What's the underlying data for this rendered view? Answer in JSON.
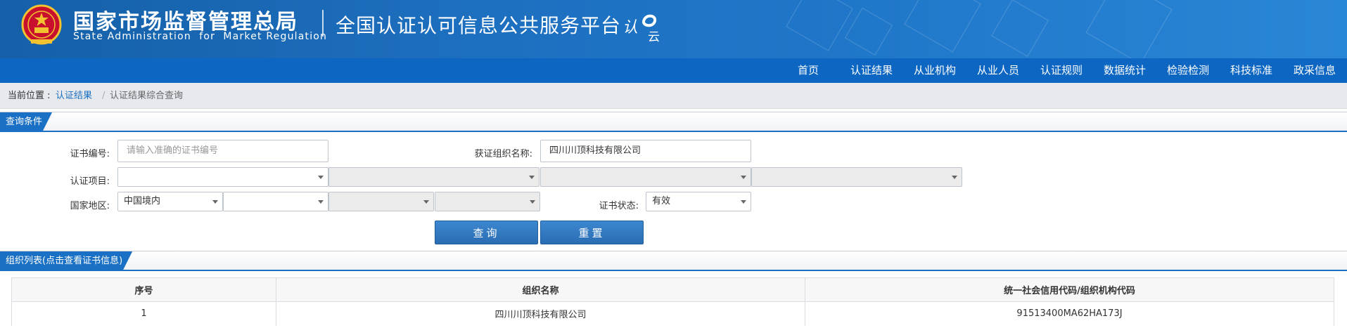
{
  "header": {
    "agency_cn": "国家市场监督管理总局",
    "agency_en": "State Administration  for  Market Regulation",
    "platform_title": "全国认证认可信息公共服务平台",
    "logo_text": "认云"
  },
  "nav": {
    "items": [
      "首页",
      "认证结果",
      "从业机构",
      "从业人员",
      "认证规则",
      "数据统计",
      "检验检测",
      "科技标准",
      "政采信息"
    ]
  },
  "breadcrumb": {
    "label": "当前位置 :",
    "link": "认证结果",
    "separator": "/",
    "current": "认证结果综合查询"
  },
  "query": {
    "title": "查询条件",
    "cert_no_label": "证书编号:",
    "cert_no_placeholder": "请输入准确的证书编号",
    "org_name_label": "获证组织名称:",
    "org_name_value": "四川川顶科技有限公司",
    "project_label": "认证项目:",
    "region_label": "国家地区:",
    "region_value": "中国境内",
    "status_label": "证书状态:",
    "status_value": "有效",
    "search_button": "查询",
    "reset_button": "重置"
  },
  "org_list": {
    "title": "组织列表(点击查看证书信息)",
    "columns": [
      "序号",
      "组织名称",
      "统一社会信用代码/组织机构代码"
    ],
    "rows": [
      {
        "index": "1",
        "name": "四川川顶科技有限公司",
        "code": "91513400MA62HA173J"
      }
    ]
  },
  "colors": {
    "header_blue": "#1d6fbf",
    "nav_blue": "#0c66c2",
    "accent": "#1a70c4",
    "button": "#2f76be"
  }
}
